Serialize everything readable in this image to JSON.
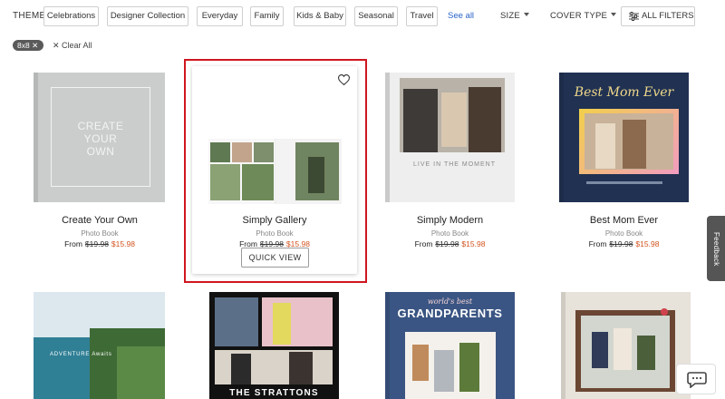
{
  "filters": {
    "theme_label": "THEME",
    "chips": [
      "Celebrations",
      "Designer Collection",
      "Everyday",
      "Family",
      "Kids & Baby",
      "Seasonal",
      "Travel"
    ],
    "see_all": "See all",
    "size_label": "SIZE",
    "cover_type_label": "COVER TYPE",
    "all_filters_label": "ALL FILTERS"
  },
  "active_filters": {
    "chip": "8x8 ✕",
    "clear_all": "✕ Clear All"
  },
  "products": [
    {
      "title": "Create Your Own",
      "subtitle": "Photo Book",
      "from": "From",
      "old_price": "$19.98",
      "new_price": "$15.98",
      "cover_text": "CREATE\nYOUR\nOWN"
    },
    {
      "title": "Simply Gallery",
      "subtitle": "Photo Book",
      "from": "From",
      "old_price": "$19.98",
      "new_price": "$15.98"
    },
    {
      "title": "Simply Modern",
      "subtitle": "Photo Book",
      "from": "From",
      "old_price": "$19.98",
      "new_price": "$15.98",
      "cover_text": "LIVE IN THE MOMENT"
    },
    {
      "title": "Best Mom Ever",
      "subtitle": "Photo Book",
      "from": "From",
      "old_price": "$19.98",
      "new_price": "$15.98",
      "cover_text": "Best Mom Ever"
    }
  ],
  "second_row": [
    {
      "cover_text": "ADVENTURE Awaits"
    },
    {
      "cover_text": "THE STRATTONS"
    },
    {
      "cover_text_top": "world's best",
      "cover_text_main": "GRANDPARENTS"
    },
    {
      "cover_text": ""
    }
  ],
  "quick_view_label": "QUICK VIEW",
  "feedback_label": "Feedback",
  "colors": {
    "accent_link": "#2a63c9",
    "sale_price": "#d2541f",
    "highlight": "#d0161e"
  }
}
